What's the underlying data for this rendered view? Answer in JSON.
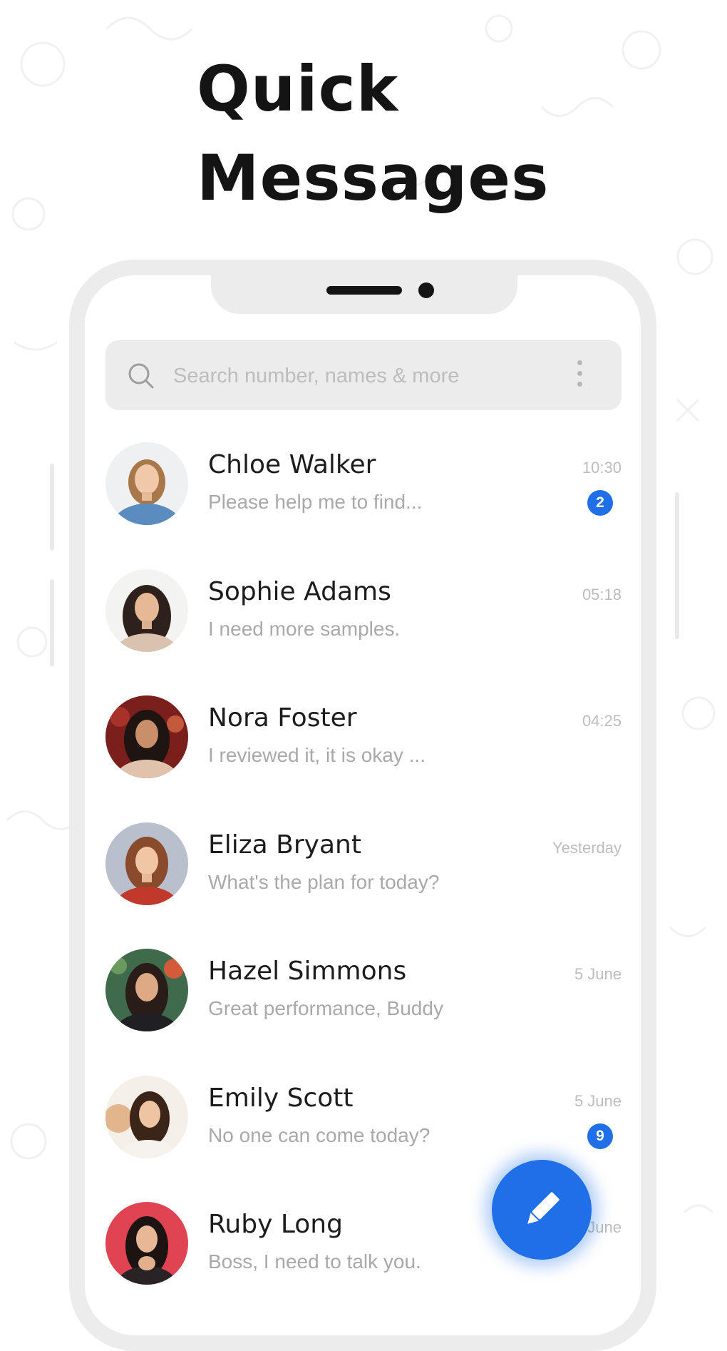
{
  "headline": {
    "line1": "Quick",
    "line2": "Messages"
  },
  "search": {
    "placeholder": "Search number, names & more"
  },
  "conversations": [
    {
      "name": "Chloe Walker",
      "preview": "Please help me to find...",
      "time": "10:30",
      "unread": "2"
    },
    {
      "name": "Sophie Adams",
      "preview": "I need more samples.",
      "time": "05:18",
      "unread": null
    },
    {
      "name": "Nora Foster",
      "preview": "I reviewed it, it is okay ...",
      "time": "04:25",
      "unread": null
    },
    {
      "name": "Eliza Bryant",
      "preview": "What's the plan for today?",
      "time": "Yesterday",
      "unread": null
    },
    {
      "name": "Hazel Simmons",
      "preview": "Great performance, Buddy",
      "time": "5 June",
      "unread": null
    },
    {
      "name": "Emily Scott",
      "preview": "No one can come today?",
      "time": "5 June",
      "unread": "9"
    },
    {
      "name": "Ruby Long",
      "preview": "Boss, I need to talk you.",
      "time": "June",
      "unread": null
    }
  ],
  "icons": {
    "search": "search-icon",
    "menu": "more-vertical-icon",
    "compose": "pencil-icon"
  },
  "colors": {
    "accent": "#1f6fe8",
    "phone_frame": "#ececec",
    "search_background": "#ececec",
    "headline": "#141414"
  }
}
